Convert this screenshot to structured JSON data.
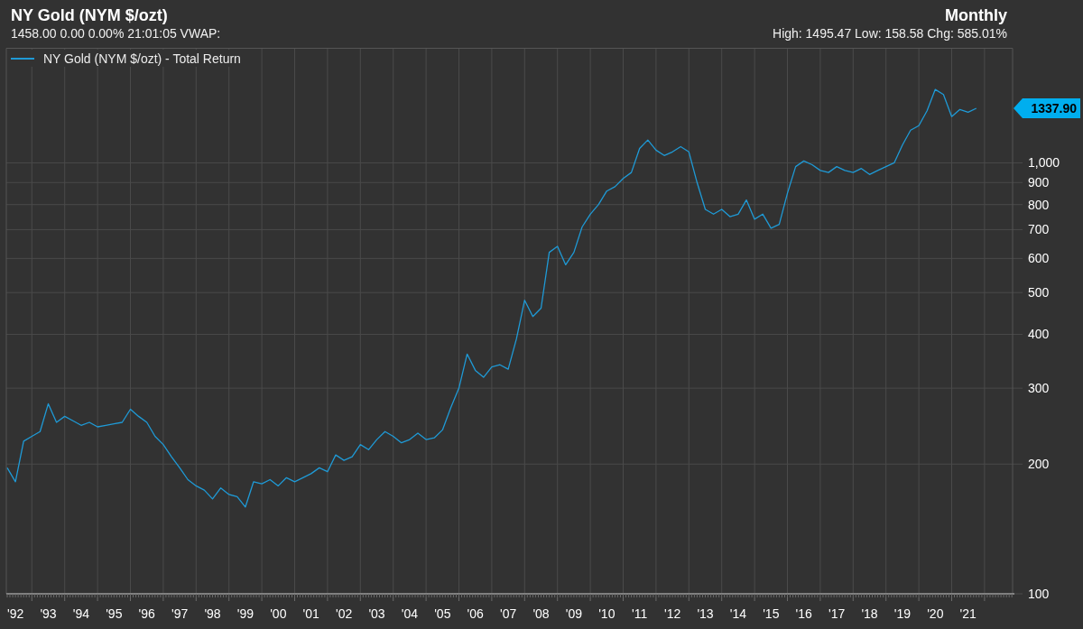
{
  "header": {
    "title": "NY Gold (NYM $/ozt)",
    "quote": "1458.00 0.00 0.00% 21:01:05 VWAP:",
    "period": "Monthly",
    "range_stats": "High: 1495.47 Low: 158.58 Chg: 585.01%"
  },
  "chart": {
    "last_price": "1337.90",
    "chart_data": {
      "type": "line",
      "log": true,
      "grid": true,
      "ylim": [
        100,
        1844
      ],
      "yticks": [
        100,
        200,
        300,
        400,
        500,
        600,
        700,
        800,
        900,
        {
          "value": 1000,
          "label": "1,000"
        }
      ],
      "categories": [
        null,
        "'92",
        null,
        null,
        null,
        "'93",
        null,
        null,
        null,
        "'94",
        null,
        null,
        null,
        "'95",
        null,
        null,
        null,
        "'96",
        null,
        null,
        null,
        "'97",
        null,
        null,
        null,
        "'98",
        null,
        null,
        null,
        "'99",
        null,
        null,
        null,
        "'00",
        null,
        null,
        null,
        "'01",
        null,
        null,
        null,
        "'02",
        null,
        null,
        null,
        "'03",
        null,
        null,
        null,
        "'04",
        null,
        null,
        null,
        "'05",
        null,
        null,
        null,
        "'06",
        null,
        null,
        null,
        "'07",
        null,
        null,
        null,
        "'08",
        null,
        null,
        null,
        "'09",
        null,
        null,
        null,
        "'10",
        null,
        null,
        null,
        "'11",
        null,
        null,
        null,
        "'12",
        null,
        null,
        null,
        "'13",
        null,
        null,
        null,
        "'14",
        null,
        null,
        null,
        "'15",
        null,
        null,
        null,
        "'16",
        null,
        null,
        null,
        "'17",
        null,
        null,
        null,
        "'18",
        null,
        null,
        null,
        "'19",
        null,
        null,
        null,
        "'20",
        null,
        null,
        null,
        "'21",
        null
      ],
      "series": [
        {
          "name": "NY Gold (NYM $/ozt) - Total Return",
          "color": "#1f9ad6",
          "values": [
            196,
            182,
            226,
            232,
            238,
            276,
            250,
            258,
            252,
            246,
            250,
            244,
            246,
            248,
            250,
            268,
            258,
            250,
            232,
            222,
            208,
            196,
            184,
            178,
            174,
            166,
            176,
            170,
            168,
            159,
            182,
            180,
            184,
            178,
            186,
            182,
            186,
            190,
            196,
            192,
            210,
            204,
            208,
            222,
            216,
            228,
            238,
            232,
            224,
            228,
            236,
            228,
            230,
            240,
            270,
            300,
            360,
            330,
            318,
            336,
            340,
            332,
            390,
            480,
            440,
            460,
            620,
            640,
            580,
            620,
            710,
            760,
            800,
            860,
            880,
            920,
            950,
            1080,
            1130,
            1070,
            1040,
            1060,
            1090,
            1060,
            900,
            780,
            760,
            780,
            750,
            760,
            820,
            740,
            760,
            705,
            720,
            850,
            980,
            1010,
            990,
            960,
            950,
            980,
            960,
            950,
            970,
            940,
            960,
            980,
            1000,
            1100,
            1190,
            1220,
            1320,
            1480,
            1440,
            1280,
            1330,
            1310,
            1338
          ]
        }
      ]
    }
  }
}
